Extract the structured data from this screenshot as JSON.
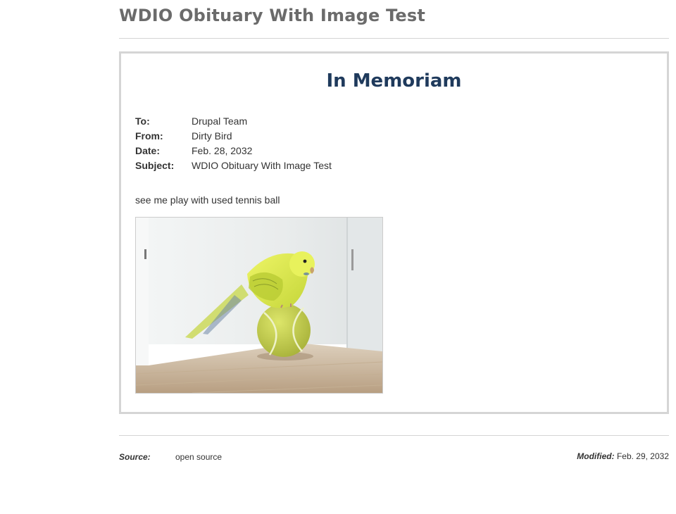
{
  "page": {
    "title": "WDIO Obituary With Image Test"
  },
  "memo": {
    "heading": "In Memoriam",
    "fields": [
      {
        "label": "To:",
        "value": "Drupal Team"
      },
      {
        "label": "From:",
        "value": "Dirty Bird"
      },
      {
        "label": "Date:",
        "value": "Feb. 28, 2032"
      },
      {
        "label": "Subject:",
        "value": "WDIO Obituary With Image Test"
      }
    ],
    "body": "see me play with used tennis ball",
    "image": {
      "icon": "parakeet-on-tennis-ball-photo",
      "colors": {
        "wall": "#eef0f0",
        "floor": "#c9b59c",
        "bird": "#d8e84a",
        "ball": "#c8d24a"
      }
    }
  },
  "footer": {
    "source_label": "Source:",
    "source_value": "open source",
    "modified_label": "Modified:",
    "modified_value": "Feb. 29, 2032"
  }
}
